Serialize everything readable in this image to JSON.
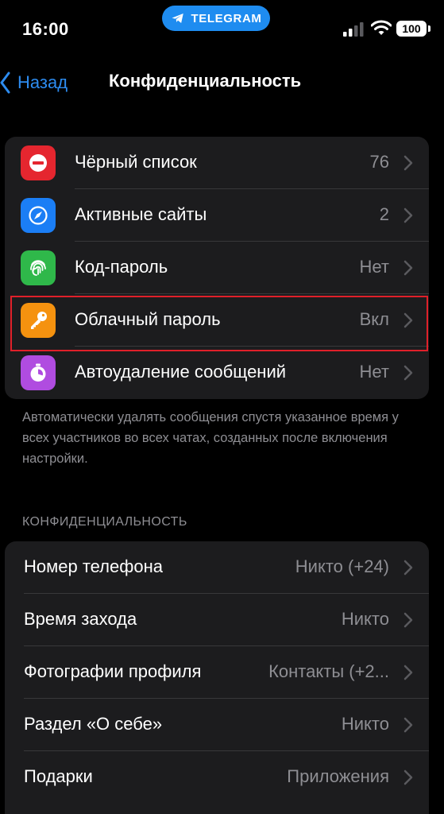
{
  "status_bar": {
    "time": "16:00",
    "app_pill": "TELEGRAM",
    "battery": "100",
    "icons": [
      "telegram-plane-icon",
      "cellular-signal-icon",
      "wifi-icon",
      "battery-icon"
    ]
  },
  "nav": {
    "back_label": "Назад",
    "title": "Конфиденциальность"
  },
  "security": {
    "items": [
      {
        "label": "Чёрный список",
        "value": "76",
        "icon": "blocked-icon",
        "color": "#e5262f"
      },
      {
        "label": "Активные сайты",
        "value": "2",
        "icon": "compass-icon",
        "color": "#1b7ef5"
      },
      {
        "label": "Код-пароль",
        "value": "Нет",
        "icon": "fingerprint-icon",
        "color": "#2fb84a"
      },
      {
        "label": "Облачный пароль",
        "value": "Вкл",
        "icon": "key-icon",
        "color": "#f5920f"
      },
      {
        "label": "Автоудаление сообщений",
        "value": "Нет",
        "icon": "timer-icon",
        "color": "#b04ce0"
      }
    ],
    "footer": "Автоматически удалять сообщения спустя указанное время у всех участников во всех чатах, созданных после включения настройки."
  },
  "privacy": {
    "header": "КОНФИДЕНЦИАЛЬНОСТЬ",
    "items": [
      {
        "label": "Номер телефона",
        "value": "Никто (+24)"
      },
      {
        "label": "Время захода",
        "value": "Никто"
      },
      {
        "label": "Фотографии профиля",
        "value": "Контакты (+2..."
      },
      {
        "label": "Раздел «О себе»",
        "value": "Никто"
      },
      {
        "label": "Подарки",
        "value": "Приложения"
      }
    ]
  },
  "colors": {
    "accent": "#2d8cf0",
    "highlight": "#e0202a",
    "background": "#000000",
    "group": "#1c1c1e",
    "secondary_text": "#8e8e93"
  }
}
